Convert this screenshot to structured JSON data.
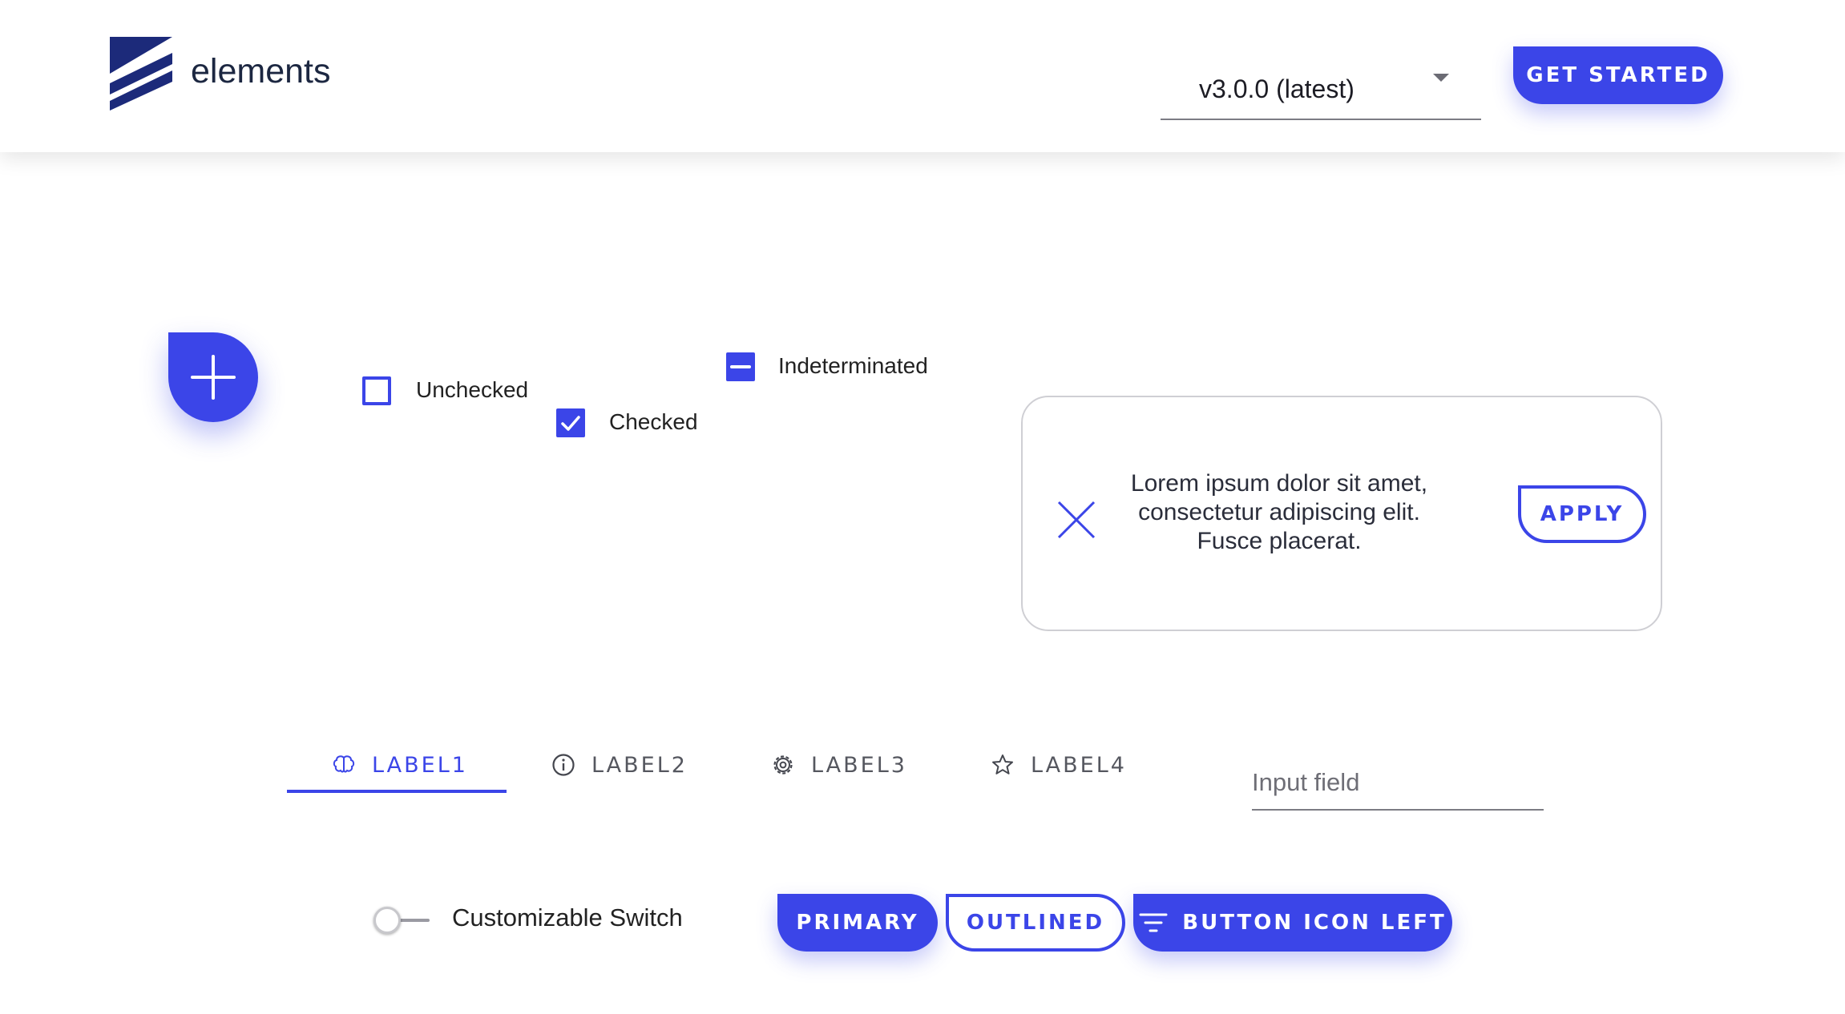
{
  "header": {
    "brand": "elements",
    "version_select": {
      "selected": "v3.0.0 (latest)"
    },
    "cta_label": "GET STARTED"
  },
  "checkboxes": [
    {
      "label": "Unchecked",
      "state": "unchecked"
    },
    {
      "label": "Checked",
      "state": "checked"
    },
    {
      "label": "Indeterminated",
      "state": "indeterminate"
    }
  ],
  "card": {
    "message": "Lorem ipsum dolor sit amet, consectetur adipiscing elit. Fusce placerat.",
    "action_label": "APPLY"
  },
  "tabs": [
    {
      "label": "LABEL1",
      "icon": "brain-icon",
      "active": true
    },
    {
      "label": "LABEL2",
      "icon": "info-icon",
      "active": false
    },
    {
      "label": "LABEL3",
      "icon": "gear-icon",
      "active": false
    },
    {
      "label": "LABEL4",
      "icon": "star-icon",
      "active": false
    }
  ],
  "input": {
    "placeholder": "Input field",
    "value": ""
  },
  "switch": {
    "label": "Customizable Switch",
    "on": false
  },
  "buttons": {
    "primary_label": "PRIMARY",
    "outlined_label": "OUTLINED",
    "icon_left_label": "BUTTON ICON LEFT",
    "icon_left_icon": "filter-icon"
  },
  "colors": {
    "accent": "#3b45e8",
    "brand_dark": "#1c2a7a",
    "text": "#1e2030"
  }
}
